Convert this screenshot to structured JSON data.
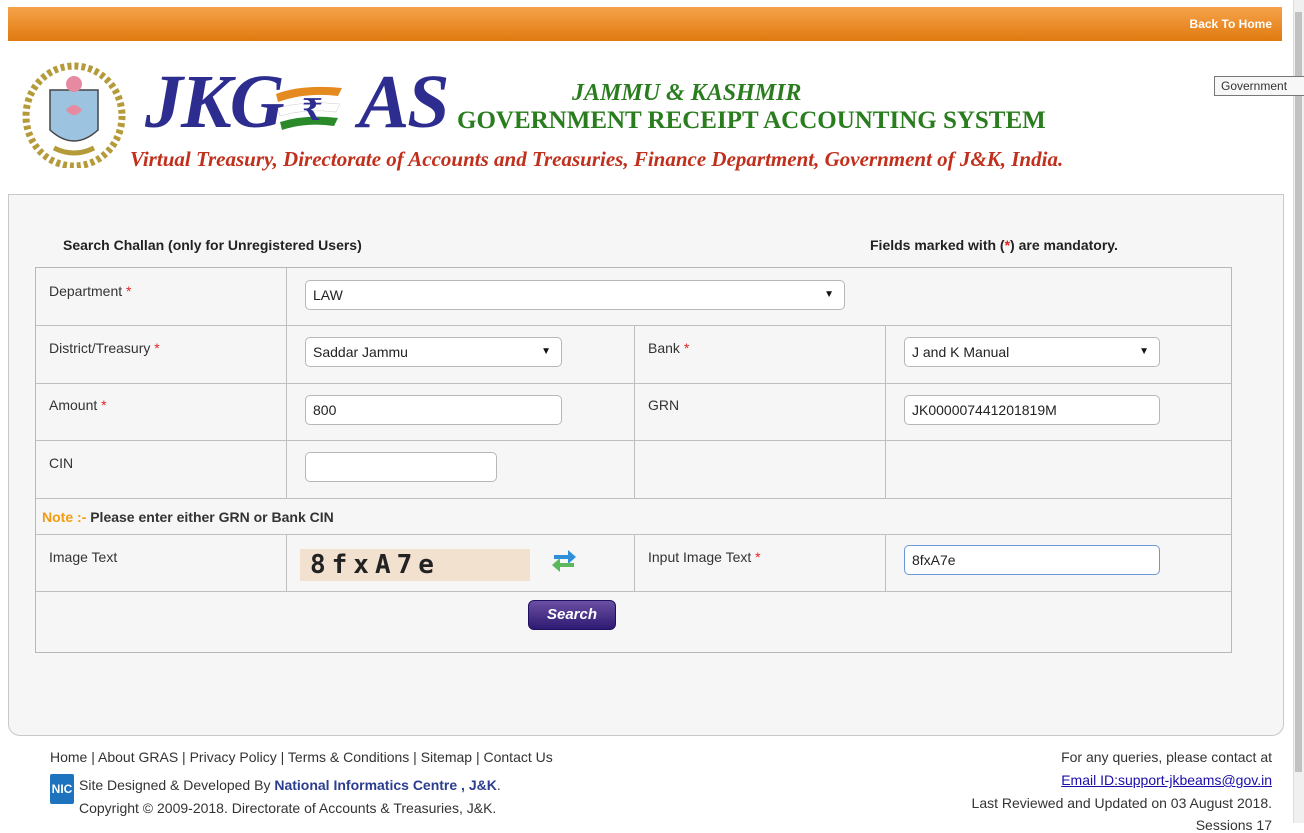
{
  "header": {
    "back_to_home": "Back To Home",
    "logo_text": "JKG",
    "logo_text_end": "AS",
    "title_line1": "JAMMU & KASHMIR",
    "title_line2": "GOVERNMENT RECEIPT ACCOUNTING SYSTEM",
    "tagline": "Virtual Treasury, Directorate of Accounts and Treasuries, Finance Department, Government of J&K, India.",
    "tooltip": "Government",
    "emblem_lettering": "JAMMU & KASHMIR"
  },
  "form": {
    "title": "Search Challan (only for Unregistered Users)",
    "mandatory_prefix": "Fields marked with (",
    "mandatory_star": "*",
    "mandatory_suffix": ") are mandatory.",
    "department_label": "Department",
    "department_value": "LAW",
    "district_label": "District/Treasury",
    "district_value": "Saddar Jammu",
    "bank_label": "Bank",
    "bank_value": "J and K Manual",
    "amount_label": "Amount",
    "amount_value": "800",
    "grn_label": "GRN",
    "grn_value": "JK000007441201819M",
    "cin_label": "CIN",
    "cin_value": "",
    "note_prefix": "Note :-",
    "note_text": "Please enter either GRN or Bank CIN",
    "image_text_label": "Image Text",
    "captcha_text": "8fxA7e",
    "input_image_text_label": "Input Image Text",
    "input_image_text_value": "8fxA7e",
    "search_button": "Search",
    "required_star": "*"
  },
  "footer": {
    "links": [
      "Home",
      "About GRAS",
      "Privacy Policy",
      "Terms & Conditions",
      "Sitemap",
      "Contact Us"
    ],
    "separator": " | ",
    "nic_logo": "NIC",
    "designed_prefix": "Site Designed & Developed By ",
    "designed_by": "National Informatics Centre , J&K",
    "designed_suffix": ".",
    "copyright": "Copyright © 2009-2018. Directorate of Accounts & Treasuries, J&K.",
    "contact": "For any queries, please contact at",
    "email": "Email ID:support-jkbeams@gov.in",
    "reviewed": "Last Reviewed and Updated on 03 August 2018.",
    "visitor": "Sessions 17"
  },
  "colors": {
    "topbar": "#e58a1f",
    "logo_blue": "#2d2c8f",
    "title_green": "#2a7d1e",
    "tagline_red": "#c0301c",
    "search_button": "#3b2782"
  }
}
